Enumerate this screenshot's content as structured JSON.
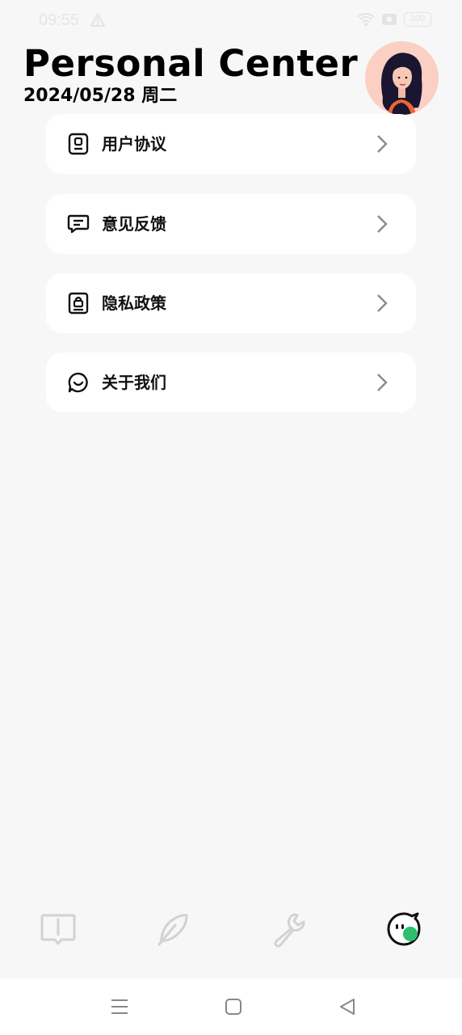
{
  "status_bar": {
    "time": "09:55",
    "battery": "100"
  },
  "header": {
    "title": "Personal Center",
    "date": "2024/05/28 周二"
  },
  "menu": [
    {
      "label": "用户协议",
      "icon": "user-agreement-icon"
    },
    {
      "label": "意见反馈",
      "icon": "feedback-icon"
    },
    {
      "label": "隐私政策",
      "icon": "privacy-policy-icon"
    },
    {
      "label": "关于我们",
      "icon": "about-us-icon"
    }
  ],
  "tabs": [
    {
      "icon": "message-book-icon",
      "active": false
    },
    {
      "icon": "feather-icon",
      "active": false
    },
    {
      "icon": "wrench-icon",
      "active": false
    },
    {
      "icon": "profile-mascot-icon",
      "active": true
    }
  ],
  "colors": {
    "accent": "#2dbf6a",
    "avatar_bg": "#fbcfc4",
    "inactive_icon": "#d2d2d2"
  }
}
